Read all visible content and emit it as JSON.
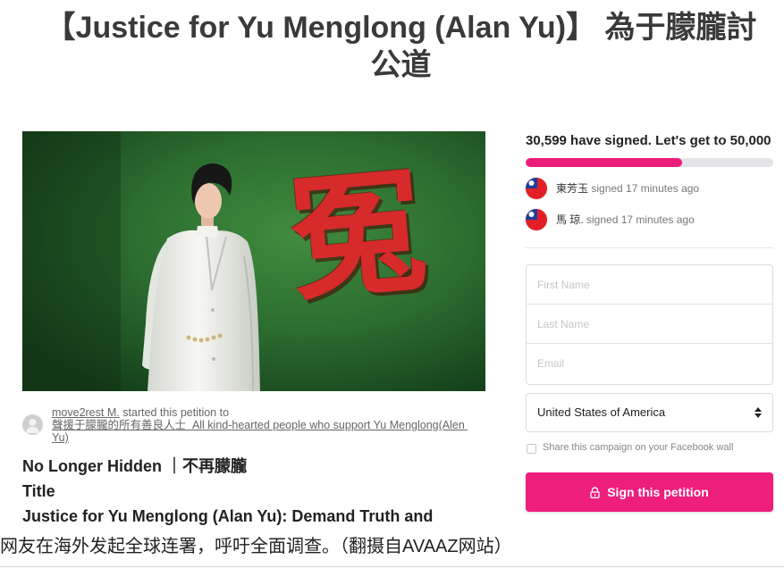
{
  "page": {
    "title_lines": [
      "【Justice for Yu Menglong (Alan Yu)】 為于朦朧討",
      "公道"
    ]
  },
  "photo": {
    "overlay_char": "冤"
  },
  "starter": {
    "avatar_icon": "user-avatar-icon",
    "name": "move2rest M.",
    "started_text": "started this petition to",
    "recipient": "聲援于朦朧的所有善良人士  All kind-hearted people who support Yu Menglong(Alen Yu)"
  },
  "petition": {
    "subtitle": "No Longer Hidden ｜不再朦朧",
    "section_label": "Title",
    "heading": "Justice for Yu Menglong (Alan Yu): Demand Truth and"
  },
  "progress": {
    "summary": "30,599 have signed. Let's get to 50,000",
    "fill_fraction": 0.63,
    "bar_color": "#ec1c7a",
    "track_color": "#e3e3e8"
  },
  "recent_signers": [
    {
      "name": "東芳玉",
      "action": "signed 17 minutes ago",
      "flag_icon": "taiwan-flag-icon"
    },
    {
      "name": "馬 琼.",
      "action": "signed 17 minutes ago",
      "flag_icon": "taiwan-flag-icon"
    }
  ],
  "form": {
    "first_name_placeholder": "First Name",
    "last_name_placeholder": "Last Name",
    "email_placeholder": "Email",
    "country": "United States of America",
    "country_select_icon": "sort-arrows-icon",
    "share_label": "Share this campaign on your Facebook wall",
    "share_checked": false,
    "submit_label": "Sign this petition",
    "submit_icon": "lock-icon",
    "submit_color": "#ee1e7d"
  },
  "caption": {
    "text": "网友在海外发起全球连署，呼吁全面调查。（翻摄自AVAAZ网站）"
  }
}
